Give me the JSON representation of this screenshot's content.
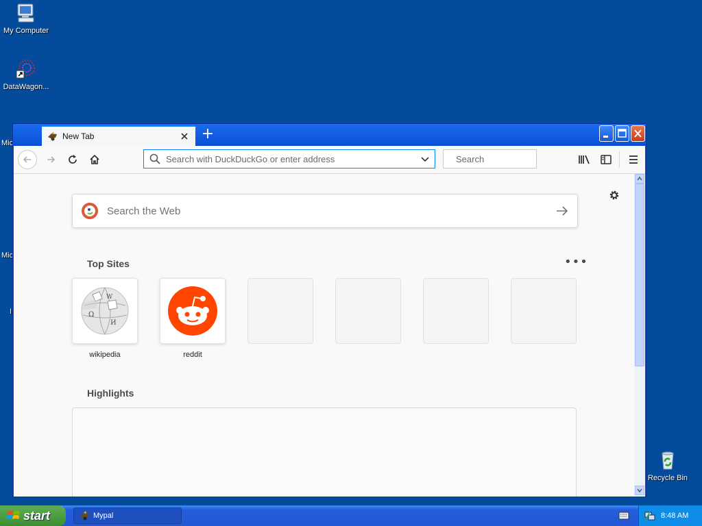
{
  "desktop": {
    "icons": [
      {
        "label": "My Computer"
      },
      {
        "label": "DataWagon..."
      },
      {
        "label": "Recycle Bin"
      }
    ],
    "partial_labels": [
      "Mic",
      "Mic",
      "I"
    ]
  },
  "browser": {
    "tab": {
      "title": "New Tab"
    },
    "new_tab_symbol": "+",
    "urlbar": {
      "placeholder": "Search with DuckDuckGo or enter address"
    },
    "searchbar": {
      "placeholder": "Search"
    },
    "web_search": {
      "placeholder": "Search the Web"
    },
    "top_sites": {
      "title": "Top Sites",
      "menu": "•••",
      "sites": [
        {
          "label": "wikipedia",
          "icon": "wikipedia-globe-icon"
        },
        {
          "label": "reddit",
          "icon": "reddit-icon"
        },
        {
          "label": ""
        },
        {
          "label": ""
        },
        {
          "label": ""
        },
        {
          "label": ""
        }
      ]
    },
    "highlights": {
      "title": "Highlights"
    }
  },
  "taskbar": {
    "start_label": "start",
    "items": [
      {
        "label": "Mypal"
      }
    ],
    "clock": "8:48 AM"
  },
  "colors": {
    "desktop": "#054b9b",
    "accent": "#0a84ff",
    "reddit": "#ff4500",
    "start": "#3c8f31"
  }
}
